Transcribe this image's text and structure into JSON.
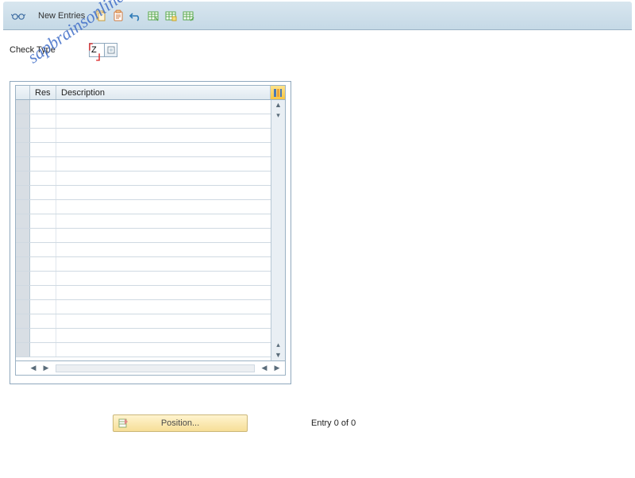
{
  "toolbar": {
    "new_entries_label": "New Entries"
  },
  "form": {
    "check_type_label": "Check Type",
    "check_type_value": "Z"
  },
  "table": {
    "columns": {
      "res": "Res",
      "description": "Description"
    },
    "row_count": 18
  },
  "footer": {
    "position_label": "Position...",
    "entry_text": "Entry 0 of 0"
  },
  "watermark": "sapbrainsonline.com"
}
